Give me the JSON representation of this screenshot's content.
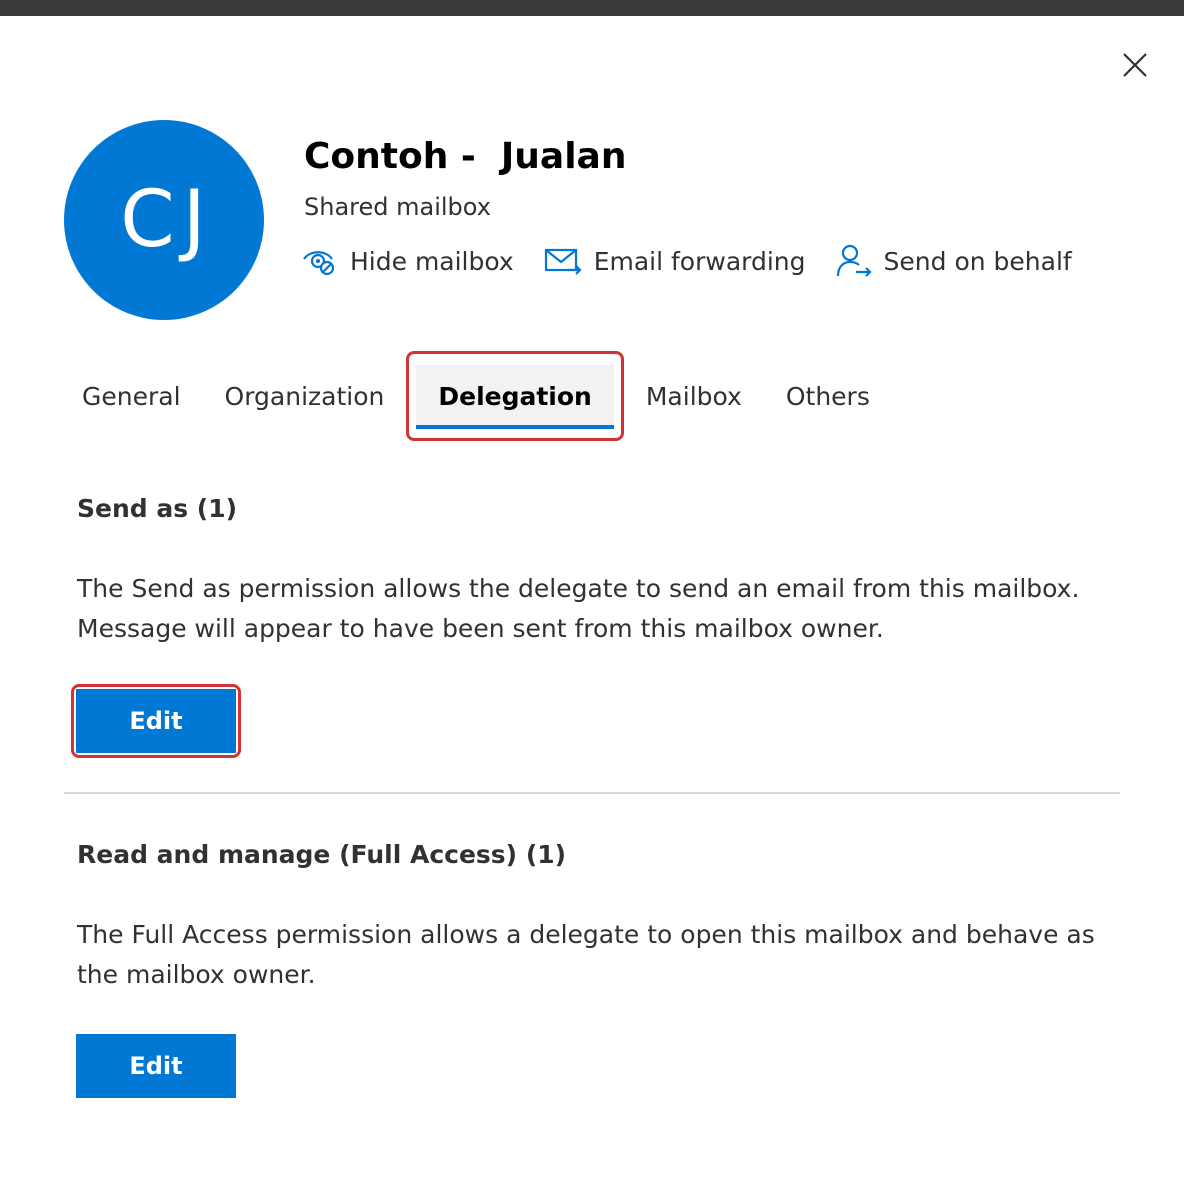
{
  "header": {
    "avatar_initials": "CJ",
    "title": "Contoh -  Jualan",
    "subtitle": "Shared mailbox",
    "close_icon": "close-icon"
  },
  "actions": [
    {
      "label": "Hide mailbox",
      "icon": "eye-hide-icon"
    },
    {
      "label": "Email forwarding",
      "icon": "envelope-forward-icon"
    },
    {
      "label": "Send on behalf",
      "icon": "person-arrow-icon"
    }
  ],
  "tabs": [
    {
      "label": "General"
    },
    {
      "label": "Organization"
    },
    {
      "label": "Delegation",
      "active": true
    },
    {
      "label": "Mailbox"
    },
    {
      "label": "Others"
    }
  ],
  "sections": {
    "send_as": {
      "heading": "Send as (1)",
      "description": "The Send as permission allows the delegate to send an email from this mailbox. Message will appear to have been sent from this mailbox owner.",
      "button": "Edit"
    },
    "full_access": {
      "heading": "Read and manage (Full Access) (1)",
      "description": "The Full Access permission allows a delegate to open this mailbox and behave as the mailbox owner.",
      "button": "Edit"
    }
  },
  "colors": {
    "accent": "#0078d4",
    "highlight": "#d13438"
  }
}
